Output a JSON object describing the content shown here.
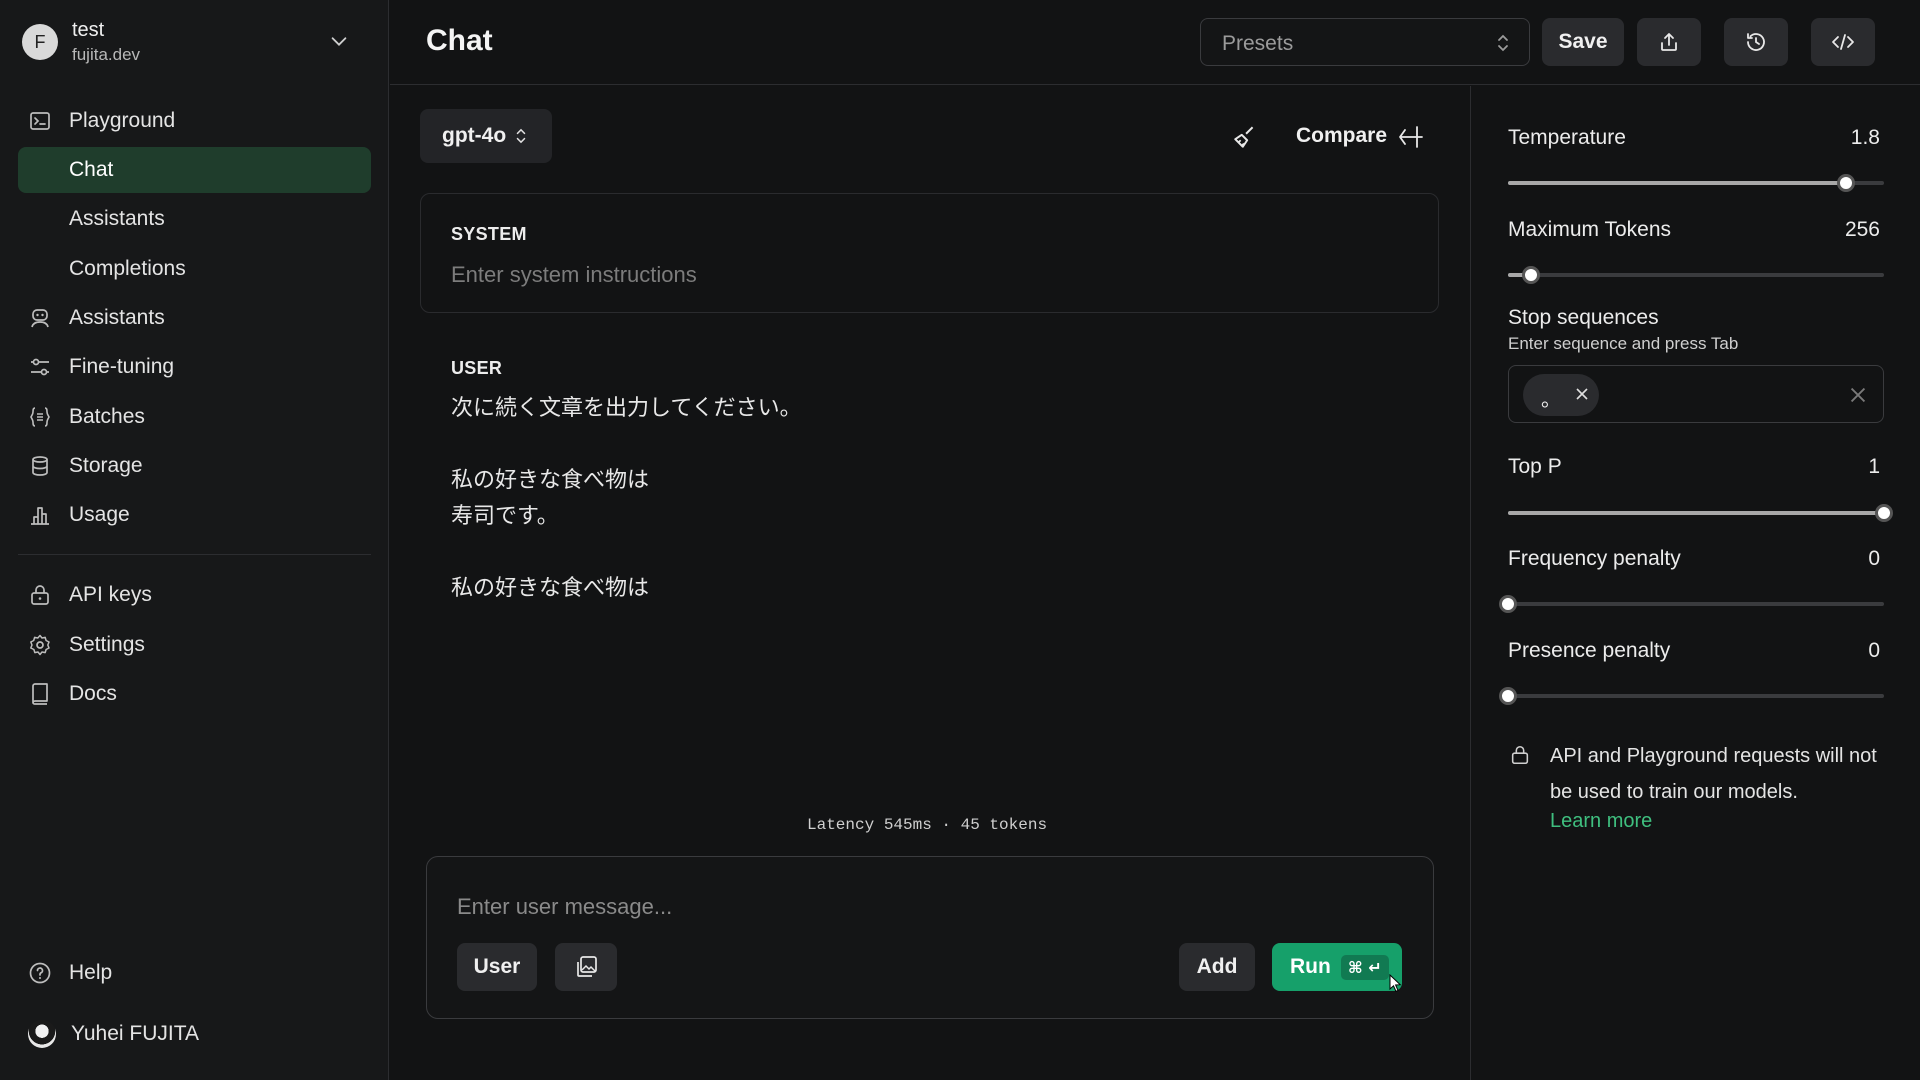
{
  "org": {
    "initial": "F",
    "name": "test",
    "domain": "fujita.dev"
  },
  "sidebar": {
    "items": [
      {
        "label": "Playground",
        "icon": "terminal-icon"
      },
      {
        "label": "Chat",
        "icon": "",
        "active": true
      },
      {
        "label": "Assistants",
        "icon": ""
      },
      {
        "label": "Completions",
        "icon": ""
      },
      {
        "label": "Assistants",
        "icon": "robot-icon"
      },
      {
        "label": "Fine-tuning",
        "icon": "sliders-icon"
      },
      {
        "label": "Batches",
        "icon": "list-braces-icon"
      },
      {
        "label": "Storage",
        "icon": "database-icon"
      },
      {
        "label": "Usage",
        "icon": "bar-chart-icon"
      }
    ],
    "secondary": [
      {
        "label": "API keys",
        "icon": "lock-icon"
      },
      {
        "label": "Settings",
        "icon": "gear-icon"
      },
      {
        "label": "Docs",
        "icon": "book-icon"
      }
    ],
    "help": "Help",
    "user": "Yuhei FUJITA"
  },
  "header": {
    "title": "Chat",
    "presets_placeholder": "Presets",
    "save_label": "Save"
  },
  "main": {
    "model": "gpt-4o",
    "compare_label": "Compare",
    "system_label": "SYSTEM",
    "system_placeholder": "Enter system instructions",
    "user_label": "USER",
    "user_message": "次に続く文章を出力してください。\n\n私の好きな食べ物は\n寿司です。\n\n私の好きな食べ物は",
    "latency": "Latency 545ms · 45 tokens",
    "composer_placeholder": "Enter user message...",
    "role_button": "User",
    "add_button": "Add",
    "run_button": "Run",
    "run_shortcut": "⌘ ↵"
  },
  "params": {
    "temperature": {
      "label": "Temperature",
      "value": "1.8",
      "fraction": 0.9
    },
    "max_tokens": {
      "label": "Maximum Tokens",
      "value": "256",
      "fraction": 0.06
    },
    "stop": {
      "label": "Stop sequences",
      "help": "Enter sequence and press Tab",
      "chips": [
        "。"
      ]
    },
    "top_p": {
      "label": "Top P",
      "value": "1",
      "fraction": 1.0
    },
    "frequency_penalty": {
      "label": "Frequency penalty",
      "value": "0",
      "fraction": 0.0
    },
    "presence_penalty": {
      "label": "Presence penalty",
      "value": "0",
      "fraction": 0.0
    }
  },
  "notice": {
    "text": "API and Playground requests will not be used to train our models.",
    "link": "Learn more"
  },
  "colors": {
    "accent": "#16a06a",
    "link": "#3fbf7f",
    "active_nav": "#1f3d2c"
  }
}
